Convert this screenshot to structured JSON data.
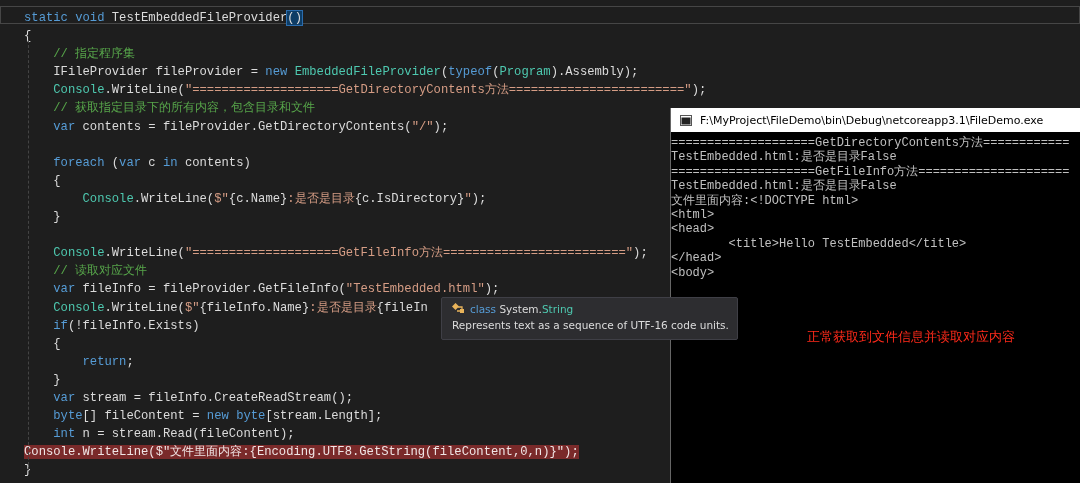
{
  "editor": {
    "lines": [
      {
        "kind": "code",
        "current": true,
        "breakpoint": false,
        "tokens": [
          {
            "kind": "keyword",
            "text": "static "
          },
          {
            "kind": "keyword",
            "text": "void "
          },
          {
            "kind": "plain",
            "text": "TestEmbeddedFileProvider"
          },
          {
            "kind": "match",
            "text": "()"
          }
        ]
      },
      {
        "kind": "code",
        "current": false,
        "breakpoint": false,
        "tokens": [
          {
            "kind": "plain",
            "text": "{"
          }
        ]
      },
      {
        "kind": "code",
        "current": false,
        "breakpoint": false,
        "tokens": [
          {
            "kind": "comment",
            "text": "    // 指定程序集"
          }
        ]
      },
      {
        "kind": "code",
        "current": false,
        "breakpoint": false,
        "tokens": [
          {
            "kind": "plain",
            "text": "    IFileProvider fileProvider = "
          },
          {
            "kind": "keyword",
            "text": "new "
          },
          {
            "kind": "type",
            "text": "EmbeddedFileProvider"
          },
          {
            "kind": "plain",
            "text": "("
          },
          {
            "kind": "keyword",
            "text": "typeof"
          },
          {
            "kind": "plain",
            "text": "("
          },
          {
            "kind": "type",
            "text": "Program"
          },
          {
            "kind": "plain",
            "text": ").Assembly);"
          }
        ]
      },
      {
        "kind": "code",
        "current": false,
        "breakpoint": false,
        "tokens": [
          {
            "kind": "type",
            "text": "    Console"
          },
          {
            "kind": "plain",
            "text": ".WriteLine("
          },
          {
            "kind": "string",
            "text": "\"====================GetDirectoryContents方法========================\""
          },
          {
            "kind": "plain",
            "text": ");"
          }
        ]
      },
      {
        "kind": "code",
        "current": false,
        "breakpoint": false,
        "tokens": [
          {
            "kind": "comment",
            "text": "    // 获取指定目录下的所有内容，包含目录和文件"
          }
        ]
      },
      {
        "kind": "code",
        "current": false,
        "breakpoint": false,
        "tokens": [
          {
            "kind": "keyword",
            "text": "    var"
          },
          {
            "kind": "plain",
            "text": " contents = fileProvider.GetDirectoryContents("
          },
          {
            "kind": "string",
            "text": "\"/\""
          },
          {
            "kind": "plain",
            "text": ");"
          }
        ]
      },
      {
        "kind": "blank"
      },
      {
        "kind": "code",
        "current": false,
        "breakpoint": false,
        "tokens": [
          {
            "kind": "keyword",
            "text": "    foreach"
          },
          {
            "kind": "plain",
            "text": " ("
          },
          {
            "kind": "keyword",
            "text": "var"
          },
          {
            "kind": "plain",
            "text": " c "
          },
          {
            "kind": "keyword",
            "text": "in"
          },
          {
            "kind": "plain",
            "text": " contents)"
          }
        ]
      },
      {
        "kind": "code",
        "current": false,
        "breakpoint": false,
        "tokens": [
          {
            "kind": "plain",
            "text": "    {"
          }
        ]
      },
      {
        "kind": "code",
        "current": false,
        "breakpoint": false,
        "tokens": [
          {
            "kind": "type",
            "text": "        Console"
          },
          {
            "kind": "plain",
            "text": ".WriteLine("
          },
          {
            "kind": "string",
            "text": "$\""
          },
          {
            "kind": "plain",
            "text": "{c.Name}"
          },
          {
            "kind": "string",
            "text": ":是否是目录"
          },
          {
            "kind": "plain",
            "text": "{c.IsDirectory}"
          },
          {
            "kind": "string",
            "text": "\""
          },
          {
            "kind": "plain",
            "text": ");"
          }
        ]
      },
      {
        "kind": "code",
        "current": false,
        "breakpoint": false,
        "tokens": [
          {
            "kind": "plain",
            "text": "    }"
          }
        ]
      },
      {
        "kind": "blank"
      },
      {
        "kind": "code",
        "current": false,
        "breakpoint": false,
        "tokens": [
          {
            "kind": "type",
            "text": "    Console"
          },
          {
            "kind": "plain",
            "text": ".WriteLine("
          },
          {
            "kind": "string",
            "text": "\"====================GetFileInfo方法=========================\""
          },
          {
            "kind": "plain",
            "text": ");"
          }
        ]
      },
      {
        "kind": "code",
        "current": false,
        "breakpoint": false,
        "tokens": [
          {
            "kind": "comment",
            "text": "    // 读取对应文件"
          }
        ]
      },
      {
        "kind": "code",
        "current": false,
        "breakpoint": false,
        "tokens": [
          {
            "kind": "keyword",
            "text": "    var"
          },
          {
            "kind": "plain",
            "text": " fileInfo = fileProvider.GetFileInfo("
          },
          {
            "kind": "string",
            "text": "\"TestEmbedded.html\""
          },
          {
            "kind": "plain",
            "text": ");"
          }
        ]
      },
      {
        "kind": "code",
        "current": false,
        "breakpoint": false,
        "tokens": [
          {
            "kind": "type",
            "text": "    Console"
          },
          {
            "kind": "plain",
            "text": ".WriteLine("
          },
          {
            "kind": "string",
            "text": "$\""
          },
          {
            "kind": "plain",
            "text": "{fileInfo.Name}"
          },
          {
            "kind": "string",
            "text": ":是否是目录"
          },
          {
            "kind": "plain",
            "text": "{fileIn"
          }
        ]
      },
      {
        "kind": "code",
        "current": false,
        "breakpoint": false,
        "tokens": [
          {
            "kind": "keyword",
            "text": "    if"
          },
          {
            "kind": "plain",
            "text": "(!fileInfo.Exists)"
          }
        ]
      },
      {
        "kind": "code",
        "current": false,
        "breakpoint": false,
        "tokens": [
          {
            "kind": "plain",
            "text": "    {"
          }
        ]
      },
      {
        "kind": "code",
        "current": false,
        "breakpoint": false,
        "tokens": [
          {
            "kind": "keyword",
            "text": "        return"
          },
          {
            "kind": "plain",
            "text": ";"
          }
        ]
      },
      {
        "kind": "code",
        "current": false,
        "breakpoint": false,
        "tokens": [
          {
            "kind": "plain",
            "text": "    }"
          }
        ]
      },
      {
        "kind": "code",
        "current": false,
        "breakpoint": false,
        "tokens": [
          {
            "kind": "keyword",
            "text": "    var"
          },
          {
            "kind": "plain",
            "text": " stream = fileInfo.CreateReadStream();"
          }
        ]
      },
      {
        "kind": "code",
        "current": false,
        "breakpoint": false,
        "tokens": [
          {
            "kind": "keyword",
            "text": "    byte"
          },
          {
            "kind": "plain",
            "text": "[] fileContent = "
          },
          {
            "kind": "keyword",
            "text": "new "
          },
          {
            "kind": "keyword",
            "text": "byte"
          },
          {
            "kind": "plain",
            "text": "[stream.Length];"
          }
        ]
      },
      {
        "kind": "code",
        "current": false,
        "breakpoint": false,
        "tokens": [
          {
            "kind": "keyword",
            "text": "    int"
          },
          {
            "kind": "plain",
            "text": " n = stream.Read(fileContent);"
          }
        ]
      },
      {
        "kind": "code",
        "current": false,
        "breakpoint": true,
        "tokens": [
          {
            "kind": "plain",
            "text": "Console.WriteLine($\"文件里面内容:{Encoding.UTF8.GetString(fileContent,0,n)}\");"
          }
        ]
      },
      {
        "kind": "code",
        "current": false,
        "breakpoint": false,
        "tokens": [
          {
            "kind": "plain",
            "text": "}"
          }
        ]
      }
    ]
  },
  "tooltip": {
    "keyword": "class",
    "namespace": "System.",
    "type": "String",
    "description": "Represents text as a sequence of UTF-16 code units."
  },
  "console_window": {
    "title": "F:\\MyProject\\FileDemo\\bin\\Debug\\netcoreapp3.1\\FileDemo.exe",
    "output": [
      "====================GetDirectoryContents方法============",
      "TestEmbedded.html:是否是目录False",
      "====================GetFileInfo方法=====================",
      "TestEmbedded.html:是否是目录False",
      "文件里面内容:<!DOCTYPE html>",
      "<html>",
      "<head>",
      "        <title>Hello TestEmbedded</title>",
      "</head>",
      "<body>"
    ],
    "annotation": "正常获取到文件信息并读取对应内容"
  }
}
